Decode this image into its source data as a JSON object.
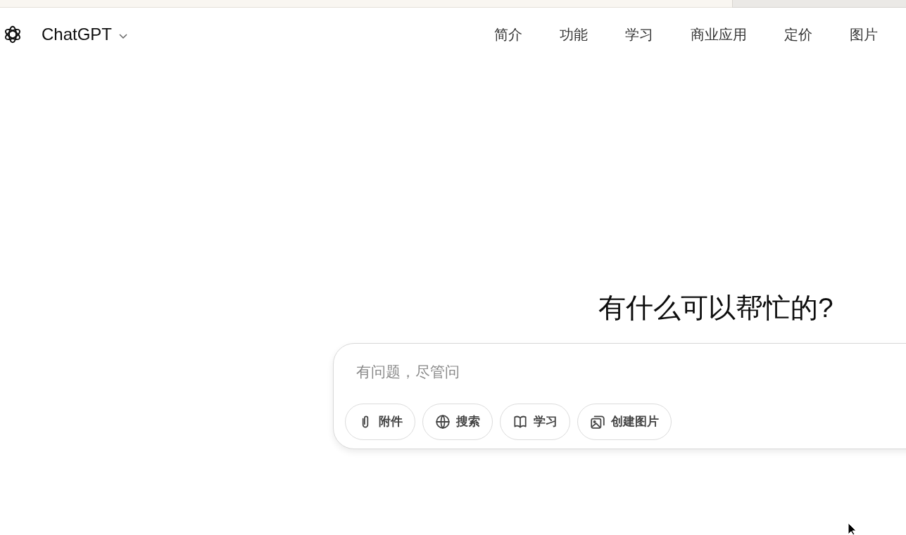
{
  "header": {
    "brand": "ChatGPT",
    "nav": [
      "简介",
      "功能",
      "学习",
      "商业应用",
      "定价",
      "图片"
    ]
  },
  "heading": "有什么可以帮忙的?",
  "composer": {
    "placeholder": "有问题，尽管问",
    "tools": [
      {
        "kind": "attach",
        "label": "附件"
      },
      {
        "kind": "search",
        "label": "搜索"
      },
      {
        "kind": "study",
        "label": "学习"
      },
      {
        "kind": "image",
        "label": "创建图片"
      }
    ]
  }
}
